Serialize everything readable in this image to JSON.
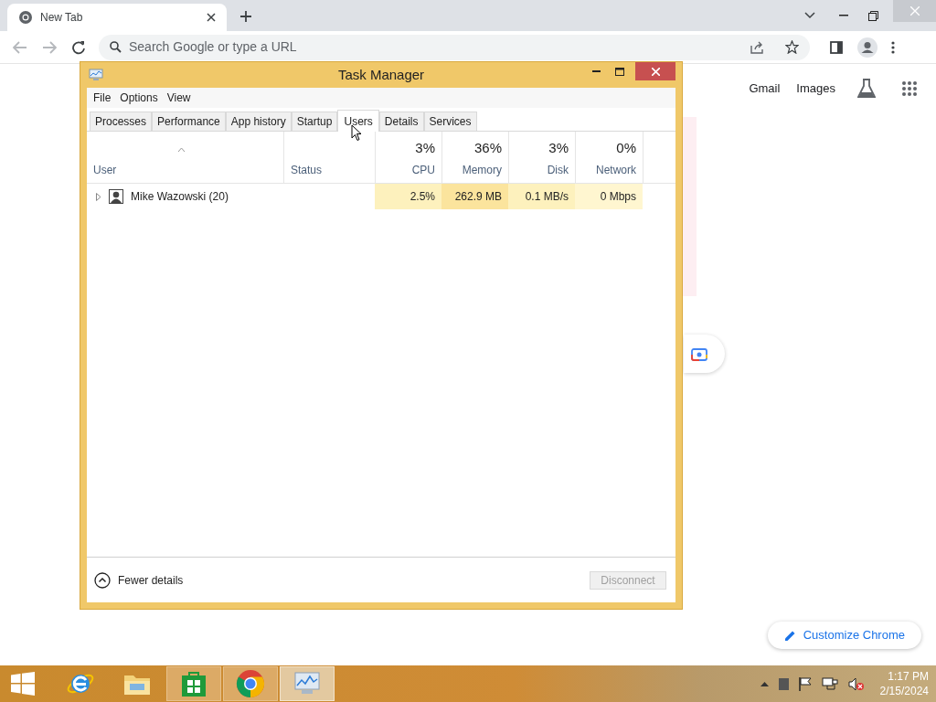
{
  "browser": {
    "tab": {
      "title": "New Tab"
    },
    "omnibox": {
      "placeholder": "Search Google or type a URL"
    },
    "links": [
      "Gmail",
      "Images"
    ],
    "customize_button": "Customize Chrome"
  },
  "task_manager": {
    "title": "Task Manager",
    "menu": [
      "File",
      "Options",
      "View"
    ],
    "tabs": [
      {
        "label": "Processes",
        "selected": false
      },
      {
        "label": "Performance",
        "selected": false
      },
      {
        "label": "App history",
        "selected": false
      },
      {
        "label": "Startup",
        "selected": false
      },
      {
        "label": "Users",
        "selected": true
      },
      {
        "label": "Details",
        "selected": false
      },
      {
        "label": "Services",
        "selected": false
      }
    ],
    "columns": [
      {
        "label": "User"
      },
      {
        "label": "Status"
      },
      {
        "label": "CPU",
        "total": "3%"
      },
      {
        "label": "Memory",
        "total": "36%"
      },
      {
        "label": "Disk",
        "total": "3%"
      },
      {
        "label": "Network",
        "total": "0%"
      }
    ],
    "rows": [
      {
        "expanded": false,
        "cells": [
          {
            "value": "Mike Wazowski (20)"
          },
          {},
          {
            "value": "2.5%",
            "color": "#fdf1bd"
          },
          {
            "value": "262.9 MB",
            "color": "#fbe49d"
          },
          {
            "value": "0.1 MB/s",
            "color": "#fdf1bd"
          },
          {
            "value": "0 Mbps",
            "color": "#fff6d0"
          }
        ]
      }
    ],
    "fewer_details": "Fewer details",
    "disconnect": {
      "label": "Disconnect",
      "disabled": true
    }
  },
  "taskbar": {
    "apps": [
      {
        "kind": "ie",
        "running": false,
        "active": false
      },
      {
        "kind": "folder",
        "running": false,
        "active": false
      },
      {
        "kind": "store",
        "running": true,
        "active": false
      },
      {
        "kind": "chrome",
        "running": true,
        "active": false
      },
      {
        "kind": "monitor",
        "running": true,
        "active": true
      }
    ],
    "time": "1:17 PM",
    "date": "2/15/2024"
  }
}
